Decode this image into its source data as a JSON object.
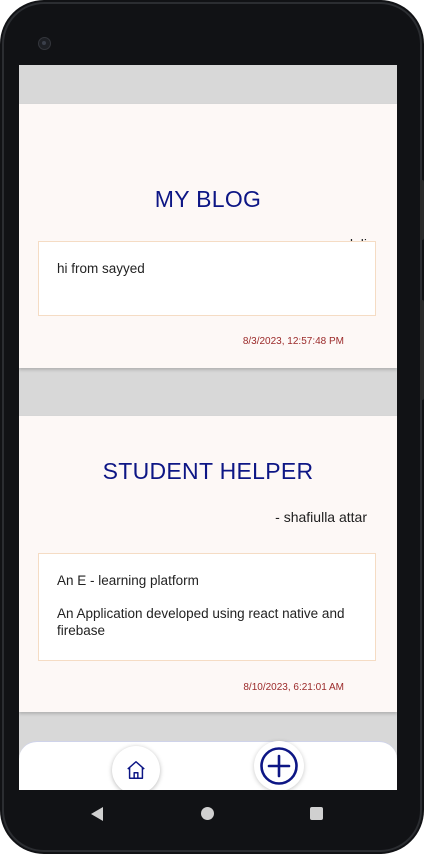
{
  "posts": [
    {
      "title": "MY BLOG",
      "author": "- sayyedali",
      "paragraphs": [
        "hi from sayyed"
      ],
      "date": "8/3/2023, 12:57:48 PM"
    },
    {
      "title": "STUDENT HELPER",
      "author": "- shafiulla attar",
      "paragraphs": [
        "An E - learning platform",
        "An Application developed using react native and firebase"
      ],
      "date": "8/10/2023, 6:21:01 AM"
    }
  ],
  "nav": {
    "home_icon": "home-icon",
    "add_icon": "plus-circle-icon"
  },
  "colors": {
    "title": "#0d1685",
    "date": "#9b2a2a",
    "card_bg": "#fdf8f6",
    "body_border": "#f5dcc4",
    "screen_bg": "#d8d8d8"
  }
}
